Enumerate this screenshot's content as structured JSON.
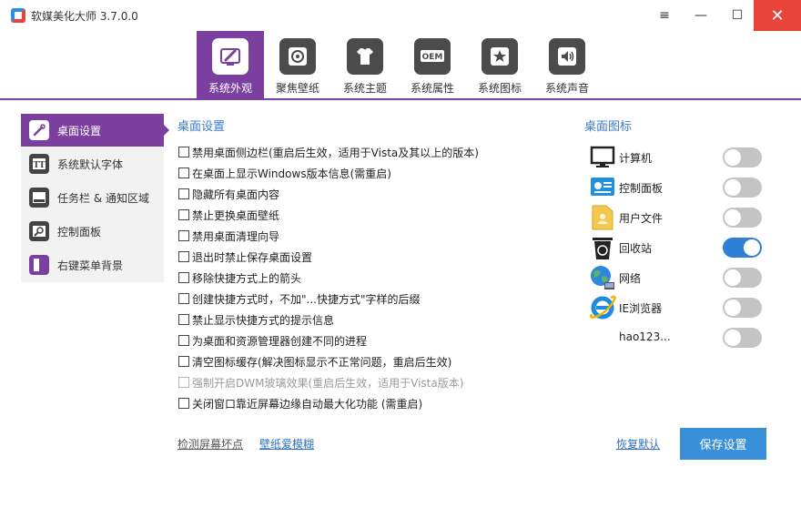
{
  "window": {
    "title": "软媒美化大师 3.7.0.0",
    "menu_glyph": "≡",
    "minimize_glyph": "—",
    "maximize_glyph": "☐",
    "close_glyph": "✕"
  },
  "tabs": [
    {
      "label": "系统外观",
      "icon": "brush-icon",
      "active": true
    },
    {
      "label": "聚焦壁纸",
      "icon": "focus-icon",
      "active": false
    },
    {
      "label": "系统主题",
      "icon": "shirt-icon",
      "active": false
    },
    {
      "label": "系统属性",
      "icon": "oem-icon",
      "active": false
    },
    {
      "label": "系统图标",
      "icon": "star-icon",
      "active": false
    },
    {
      "label": "系统声音",
      "icon": "speaker-icon",
      "active": false
    }
  ],
  "sidebar": {
    "items": [
      {
        "label": "桌面设置",
        "icon": "desktop-settings-icon",
        "active": true
      },
      {
        "label": "系统默认字体",
        "icon": "font-icon",
        "active": false
      },
      {
        "label": "任务栏 & 通知区域",
        "icon": "taskbar-icon",
        "active": false
      },
      {
        "label": "控制面板",
        "icon": "control-panel-icon",
        "active": false
      },
      {
        "label": "右键菜单背景",
        "icon": "context-menu-icon",
        "active": false
      }
    ]
  },
  "desktop_settings": {
    "title": "桌面设置",
    "options": [
      {
        "label": "禁用桌面侧边栏(重启后生效，适用于Vista及其以上的版本)",
        "checked": false,
        "enabled": true
      },
      {
        "label": "在桌面上显示Windows版本信息(需重启)",
        "checked": false,
        "enabled": true
      },
      {
        "label": "隐藏所有桌面内容",
        "checked": false,
        "enabled": true
      },
      {
        "label": "禁止更换桌面壁纸",
        "checked": false,
        "enabled": true
      },
      {
        "label": "禁用桌面清理向导",
        "checked": false,
        "enabled": true
      },
      {
        "label": "退出时禁止保存桌面设置",
        "checked": false,
        "enabled": true
      },
      {
        "label": "移除快捷方式上的箭头",
        "checked": false,
        "enabled": true
      },
      {
        "label": "创建快捷方式时，不加\"...快捷方式\"字样的后缀",
        "checked": false,
        "enabled": true
      },
      {
        "label": "禁止显示快捷方式的提示信息",
        "checked": false,
        "enabled": true
      },
      {
        "label": "为桌面和资源管理器创建不同的进程",
        "checked": false,
        "enabled": true
      },
      {
        "label": "清空图标缓存(解决图标显示不正常问题，重启后生效)",
        "checked": false,
        "enabled": true
      },
      {
        "label": "强制开启DWM玻璃效果(重启后生效，适用于Vista版本)",
        "checked": false,
        "enabled": false
      },
      {
        "label": "关闭窗口靠近屏幕边缘自动最大化功能 (需重启)",
        "checked": false,
        "enabled": true
      }
    ]
  },
  "desktop_icons": {
    "title": "桌面图标",
    "items": [
      {
        "label": "计算机",
        "icon": "computer-icon",
        "on": false
      },
      {
        "label": "控制面板",
        "icon": "control-panel-icon",
        "on": false
      },
      {
        "label": "用户文件",
        "icon": "user-folder-icon",
        "on": false
      },
      {
        "label": "回收站",
        "icon": "recycle-bin-icon",
        "on": true
      },
      {
        "label": "网络",
        "icon": "network-icon",
        "on": false
      },
      {
        "label": "IE浏览器",
        "icon": "ie-icon",
        "on": false
      },
      {
        "label": "hao123...",
        "icon": "",
        "on": false
      }
    ]
  },
  "footer": {
    "detect_pixels": "检测屏幕坏点",
    "wallpaper_blur": "壁纸爱模糊",
    "restore_default": "恢复默认",
    "save": "保存设置"
  },
  "colors": {
    "accent_purple": "#7b3fa0",
    "link_blue": "#2f6fbf",
    "section_blue": "#3b7ccf",
    "toggle_on": "#2f7ed8",
    "close_red": "#e8443a"
  }
}
